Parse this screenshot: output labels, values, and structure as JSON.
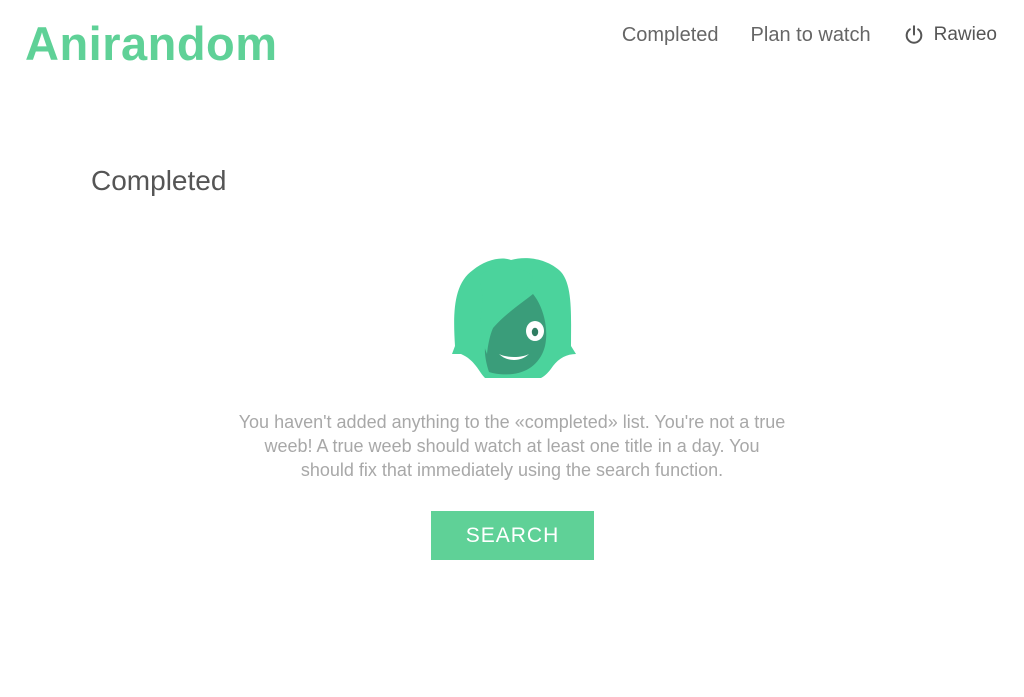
{
  "header": {
    "logo_text": "Anirandom",
    "nav": {
      "completed_label": "Completed",
      "plan_to_watch_label": "Plan to watch",
      "user_name": "Rawieo",
      "user_icon": "power-icon"
    }
  },
  "main": {
    "title": "Completed",
    "mascot_icon": "anime-girl-mascot",
    "empty_message": "You haven't added anything to the «completed» list. You're not a true weeb! A true weeb should watch at least one title in a day. You should fix that immediately using the search function.",
    "search_button_label": "SEARCH"
  },
  "colors": {
    "brand": "#5fd197",
    "mascot_hair": "#4bd39c",
    "mascot_face": "#3a9d7a",
    "text_dark": "#555555",
    "text_muted": "#a8a8a8"
  }
}
